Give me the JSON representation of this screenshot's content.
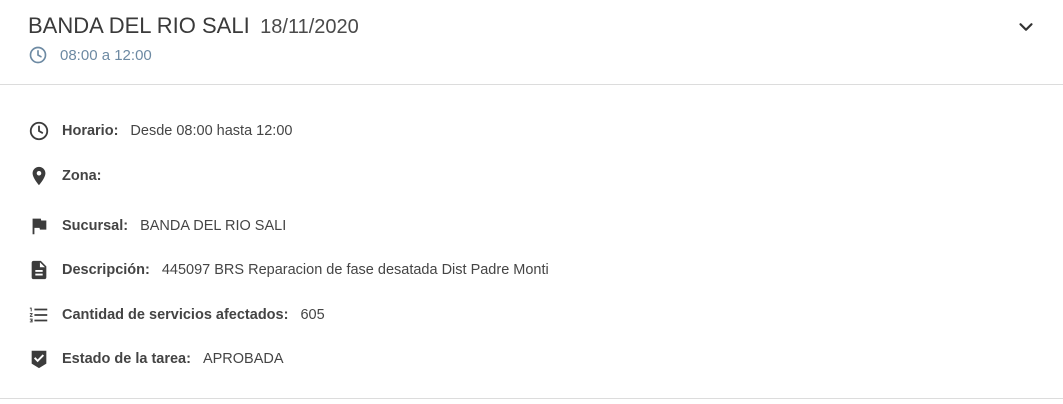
{
  "header": {
    "title": "BANDA DEL RIO SALI",
    "date": "18/11/2020",
    "time_range": "08:00 a 12:00",
    "icons": {
      "clock": "clock-icon",
      "expand": "chevron-down-icon"
    }
  },
  "details": {
    "horario": {
      "label": "Horario:",
      "value": "Desde 08:00 hasta 12:00",
      "icon": "clock-icon"
    },
    "zona": {
      "label": "Zona:",
      "value": "",
      "icon": "location-pin-icon"
    },
    "sucursal": {
      "label": "Sucursal:",
      "value": "BANDA DEL RIO SALI",
      "icon": "flag-icon"
    },
    "descripcion": {
      "label": "Descripción:",
      "value": "445097 BRS Reparacion de fase desatada Dist Padre Monti",
      "icon": "document-icon"
    },
    "cantidad": {
      "label": "Cantidad de servicios afectados:",
      "value": "605",
      "icon": "list-icon"
    },
    "estado": {
      "label": "Estado de la tarea:",
      "value": "APROBADA",
      "icon": "badge-check-icon"
    }
  },
  "colors": {
    "accent_subtitle": "#6d8aa3",
    "divider": "#dcdcdc",
    "text": "#3b3b3b"
  }
}
